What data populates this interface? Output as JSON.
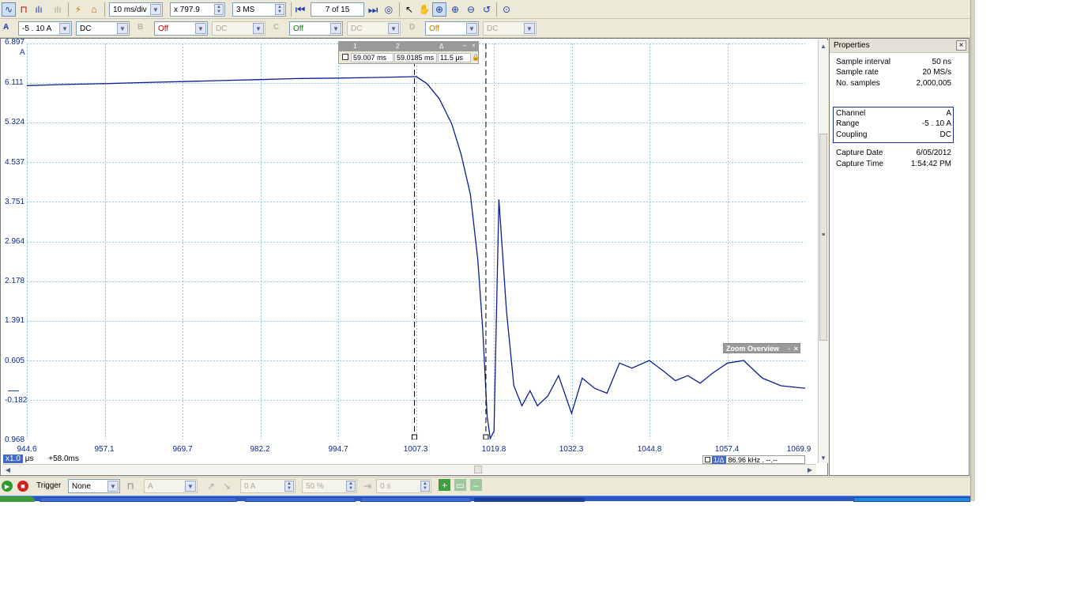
{
  "toolbar": {
    "timebase": "10 ms/div",
    "zoom": "x 797.9",
    "samples": "3 MS",
    "buffer": "7 of 15"
  },
  "channels": {
    "a": {
      "label": "A",
      "range": "-5 . 10 A",
      "coupling": "DC"
    },
    "b": {
      "label": "B",
      "range": "Off",
      "coupling": "DC"
    },
    "c": {
      "label": "C",
      "range": "Off",
      "coupling": "DC"
    },
    "d": {
      "label": "D",
      "range": "Off",
      "coupling": "DC"
    }
  },
  "scope": {
    "y_ticks": [
      "6.897",
      "6.111",
      "5.324",
      "4.537",
      "3.751",
      "2.964",
      "2.178",
      "1.391",
      "0.605",
      "-0.182",
      "0.968"
    ],
    "y_unit": "A",
    "x_ticks": [
      "944.6",
      "957.1",
      "969.7",
      "982.2",
      "994.7",
      "1007.3",
      "1019.8",
      "1032.3",
      "1044.8",
      "1057.4",
      "1069.9"
    ],
    "x_multiplier": "x1.0",
    "x_unit": "μs",
    "x_offset": "+58.0ms",
    "trace_color": "#0a1f8f",
    "grid_color": "#8fc8e0"
  },
  "measurement": {
    "headers": [
      "1",
      "2",
      "Δ"
    ],
    "values": [
      "59.007 ms",
      "59.0185 ms",
      "11.5 μs"
    ]
  },
  "zoom_overview": "Zoom Overview",
  "frequency": {
    "tag": "1/Δ",
    "value": "86.96 kHz . --.--"
  },
  "properties": {
    "title": "Properties",
    "rows": [
      {
        "label": "Sample interval",
        "value": "50 ns"
      },
      {
        "label": "Sample rate",
        "value": "20 MS/s"
      },
      {
        "label": "No. samples",
        "value": "2,000,005"
      }
    ],
    "channel_rows": [
      {
        "label": "Channel",
        "value": "A"
      },
      {
        "label": "Range",
        "value": "-5 . 10 A"
      },
      {
        "label": "Coupling",
        "value": "DC"
      }
    ],
    "capture_rows": [
      {
        "label": "Capture Date",
        "value": "6/05/2012"
      },
      {
        "label": "Capture Time",
        "value": "1:54:42 PM"
      }
    ]
  },
  "status": {
    "trigger_label": "Trigger",
    "trigger_mode": "None",
    "trigger_source": "A",
    "trigger_level": "0 A",
    "trigger_percent": "50 %",
    "trigger_delay": "0 s"
  },
  "chart_data": {
    "type": "line",
    "xlabel": "μs",
    "ylabel": "A",
    "xlim": [
      944.6,
      1069.9
    ],
    "ylim": [
      -0.968,
      6.897
    ],
    "series": [
      {
        "x": [
          944.6,
          950,
          957.1,
          963,
          969.7,
          976,
          982.2,
          988,
          994.7,
          1000,
          1004,
          1007.3,
          1009,
          1011,
          1013,
          1014.5,
          1016,
          1017.2,
          1018,
          1018.7,
          1019.2,
          1019.8,
          1020.6,
          1021.8,
          1023,
          1024.3,
          1025.6,
          1026.8,
          1028.5,
          1030.2,
          1032.3,
          1034,
          1036,
          1038,
          1040,
          1042,
          1044.8,
          1047,
          1049,
          1051,
          1053,
          1055,
          1057.4,
          1060,
          1063,
          1066,
          1069.9
        ],
        "y": [
          6.06,
          6.08,
          6.1,
          6.12,
          6.14,
          6.16,
          6.18,
          6.2,
          6.21,
          6.22,
          6.23,
          6.24,
          6.1,
          5.8,
          5.3,
          4.7,
          3.9,
          2.6,
          1.2,
          -0.5,
          -0.95,
          -0.8,
          3.8,
          1.6,
          0.1,
          -0.3,
          0.0,
          -0.3,
          -0.1,
          0.3,
          -0.45,
          0.25,
          0.05,
          -0.05,
          0.55,
          0.45,
          0.6,
          0.4,
          0.2,
          0.3,
          0.15,
          0.35,
          0.55,
          0.6,
          0.25,
          0.1,
          0.05
        ]
      }
    ]
  }
}
